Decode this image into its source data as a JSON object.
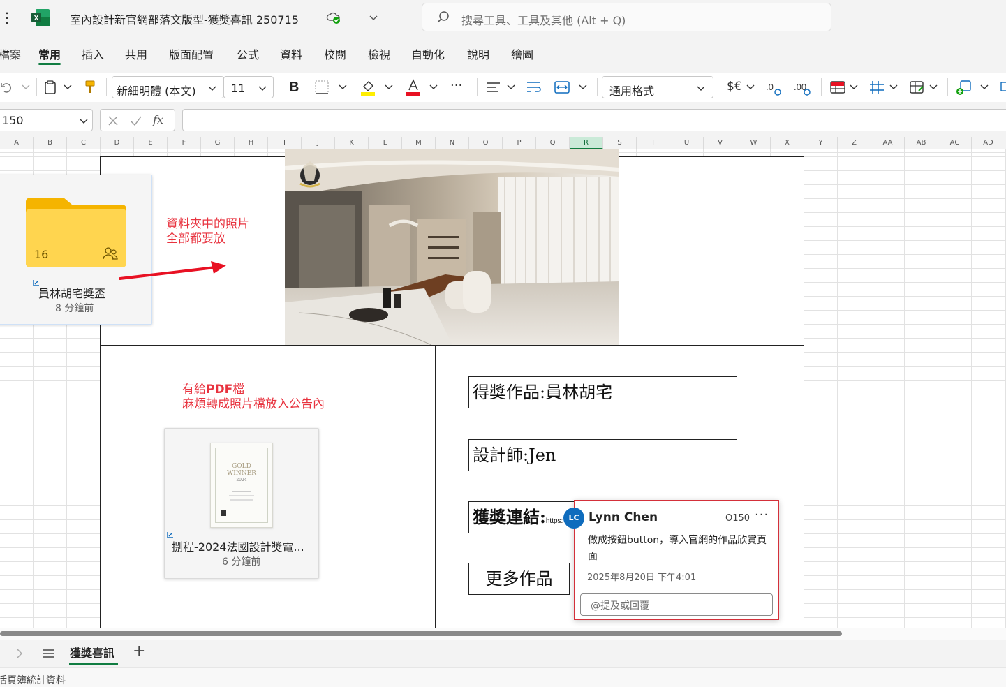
{
  "titlebar": {
    "doc_title": "室內設計新官網部落文版型-獲獎喜訊  250715",
    "search_placeholder": "搜尋工具、工具及其他 (Alt + Q)"
  },
  "menu": {
    "tabs": [
      "檔案",
      "常用",
      "插入",
      "共用",
      "版面配置",
      "公式",
      "資料",
      "校閱",
      "檢視",
      "自動化",
      "說明",
      "繪圖"
    ],
    "active": "常用"
  },
  "ribbon": {
    "font_name": "新細明體 (本文)",
    "font_size": "11",
    "number_format": "通用格式",
    "currency_label": "$€",
    "more": "···"
  },
  "formula_bar": {
    "name_box": "150",
    "fx": "fx"
  },
  "grid": {
    "columns": [
      "A",
      "B",
      "C",
      "D",
      "E",
      "F",
      "G",
      "H",
      "I",
      "J",
      "K",
      "L",
      "M",
      "N",
      "O",
      "P",
      "Q",
      "R",
      "S",
      "T",
      "U",
      "V",
      "W",
      "X",
      "Y",
      "Z",
      "AA",
      "AB",
      "AC",
      "AD"
    ],
    "selected_column": "R"
  },
  "folder_card": {
    "count": "16",
    "name": "員林胡宅獎盃",
    "time": "8 分鐘前"
  },
  "note1": {
    "line1": "資料夾中的照片",
    "line2": "全部都要放"
  },
  "note2": {
    "line1_prefix": "有給",
    "line1_bold": "PDF",
    "line1_suffix": "檔",
    "line2": "麻煩轉成照片檔放入公告內"
  },
  "pdf_card": {
    "name": "捌程-2024法國設計獎電...",
    "time": "6 分鐘前",
    "thumb_line1": "GOLD",
    "thumb_line2": "WINNER",
    "thumb_year": "2024"
  },
  "info": {
    "award_work": "得獎作品:員林胡宅",
    "designer": "設計師:Jen",
    "award_link_label": "獲獎連結:",
    "award_link_url": "https:",
    "more_works": "更多作品"
  },
  "comment": {
    "initials": "LC",
    "author": "Lynn Chen",
    "cell": "O150",
    "more": "···",
    "body": "做成按鈕button，導入官網的作品欣賞頁面",
    "date": "2025年8月20日 下午4:01",
    "reply_placeholder": "@提及或回覆"
  },
  "sheets": {
    "active": "獲獎喜訊",
    "add": "+"
  },
  "status": {
    "text": "活頁簿統計資料"
  },
  "colors": {
    "excel_green": "#107c41",
    "annotation_red": "#e8333f",
    "comment_border": "#d4303a",
    "avatar_blue": "#0f6cbd",
    "folder_yellow": "#ffd54f"
  }
}
